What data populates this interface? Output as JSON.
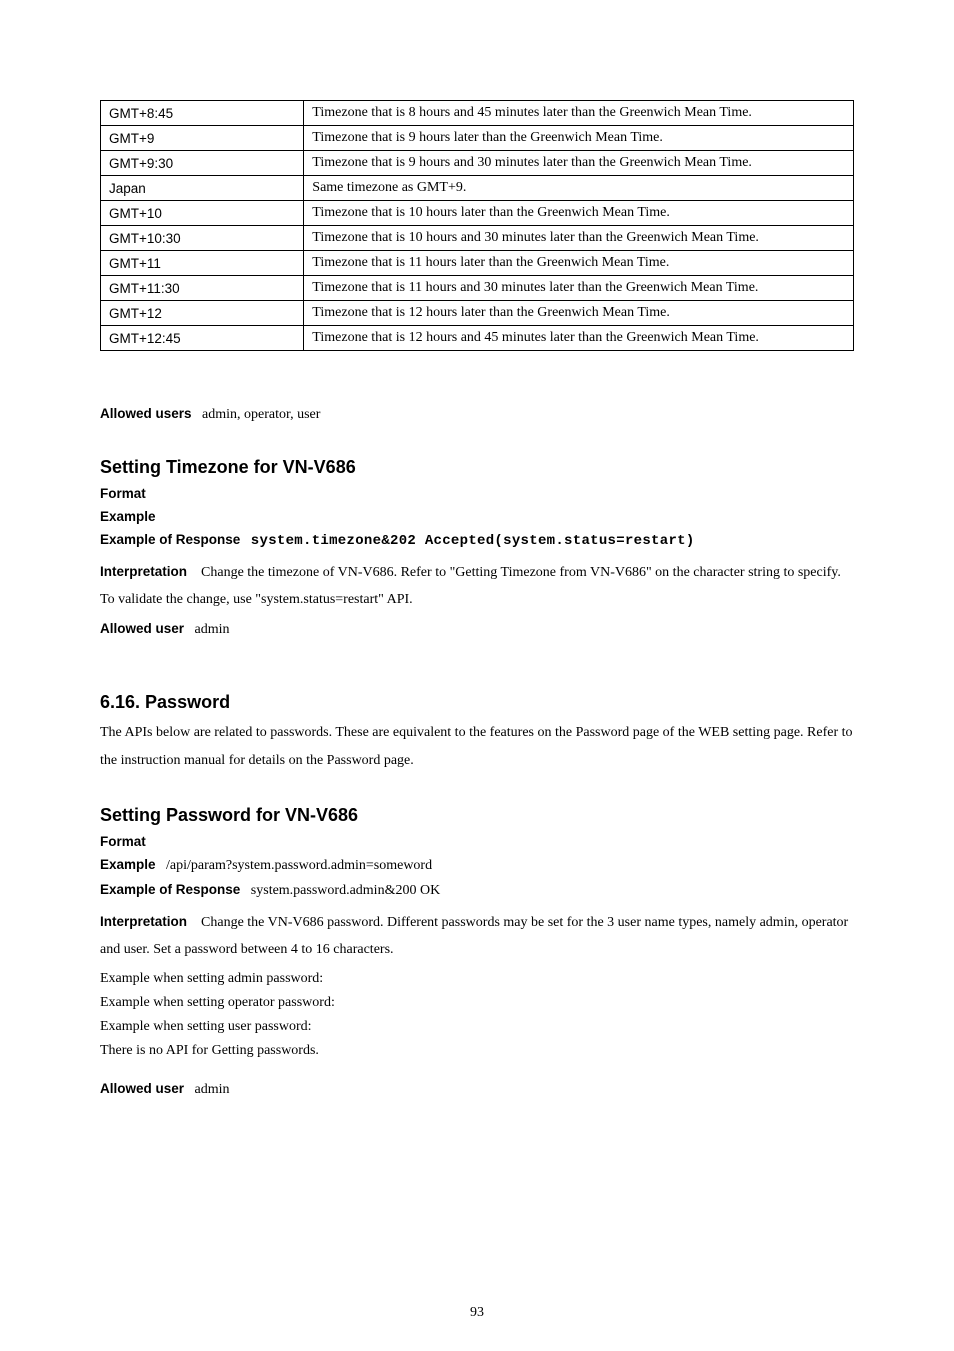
{
  "table": {
    "rows": [
      {
        "tz": "GMT+8:45",
        "desc": "Timezone that is 8 hours and 45 minutes later than the Greenwich Mean Time."
      },
      {
        "tz": "GMT+9",
        "desc": "Timezone that is 9 hours later than the Greenwich Mean Time."
      },
      {
        "tz": "GMT+9:30",
        "desc": "Timezone that is 9 hours and 30 minutes later than the Greenwich Mean Time."
      },
      {
        "tz": "Japan",
        "desc": "Same timezone as GMT+9."
      },
      {
        "tz": "GMT+10",
        "desc": "Timezone that is 10 hours later than the Greenwich Mean Time."
      },
      {
        "tz": "GMT+10:30",
        "desc": "Timezone that is 10 hours and 30 minutes later than the Greenwich Mean Time."
      },
      {
        "tz": "GMT+11",
        "desc": "Timezone that is 11 hours later than the Greenwich Mean Time."
      },
      {
        "tz": "GMT+11:30",
        "desc": "Timezone that is 11 hours and 30 minutes later than the Greenwich Mean Time."
      },
      {
        "tz": "GMT+12",
        "desc": "Timezone that is 12 hours later than the Greenwich Mean Time."
      },
      {
        "tz": "GMT+12:45",
        "desc": "Timezone that is 12 hours and 45 minutes later than the Greenwich Mean Time."
      }
    ]
  },
  "allowed_users": {
    "label": "Allowed users",
    "value": "admin, operator, user"
  },
  "setting_timezone": {
    "heading": "Setting Timezone for VN-V686",
    "format_label": "Format",
    "example_label": "Example",
    "example_response_label": "Example of Response",
    "example_response_value": "system.timezone&202 Accepted(system.status=restart)",
    "interpretation_label": "Interpretation",
    "interpretation_text": "Change the timezone of VN-V686. Refer to \"Getting Timezone from VN-V686\" on the character string to specify. To validate the change, use \"system.status=restart\" API.",
    "allowed_user_label": "Allowed user",
    "allowed_user_value": "admin"
  },
  "password_section": {
    "heading": "6.16. Password",
    "body": "The APIs below are related to passwords. These are equivalent to the features on the Password page of the WEB setting page. Refer to the instruction manual for details on the Password page."
  },
  "setting_password": {
    "heading": "Setting Password for VN-V686",
    "format_label": "Format",
    "example_label": "Example",
    "example_value": "/api/param?system.password.admin=someword",
    "example_response_label": "Example of Response",
    "example_response_value": "system.password.admin&200 OK",
    "interpretation_label": "Interpretation",
    "interpretation_text": "Change the VN-V686 password. Different passwords may be set for the 3 user name types, namely admin, operator and user. Set a password between 4 to 16 characters.",
    "example_admin": "Example when setting admin password:",
    "example_operator": "Example when setting operator password:",
    "example_user": "Example when setting user password:",
    "no_api": "There is no API for Getting passwords.",
    "allowed_user_label": "Allowed user",
    "allowed_user_value": "admin"
  },
  "page_number": "93"
}
